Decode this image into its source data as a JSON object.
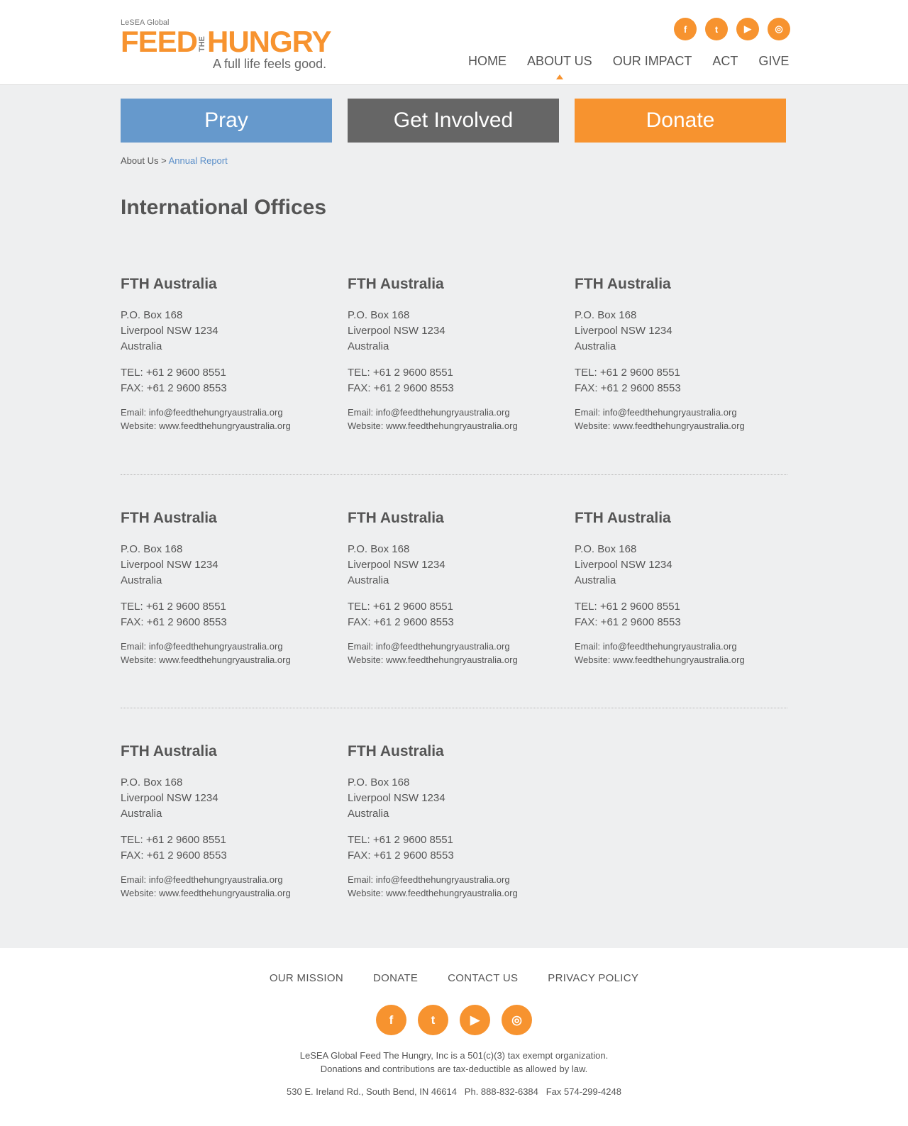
{
  "brand": {
    "small": "LeSEA Global",
    "feed": "FEED",
    "the": "THE",
    "hungry": "HUNGRY",
    "tagline": "A full life feels good."
  },
  "social_icons": [
    "facebook-icon",
    "twitter-icon",
    "youtube-icon",
    "instagram-icon"
  ],
  "social_glyphs": [
    "f",
    "t",
    "▶",
    "◎"
  ],
  "nav": {
    "items": [
      "HOME",
      "ABOUT US",
      "OUR IMPACT",
      "ACT",
      "GIVE"
    ],
    "active": "ABOUT US"
  },
  "cta": {
    "pray": "Pray",
    "involved": "Get Involved",
    "donate": "Donate"
  },
  "colors": {
    "accent": "#f7932f",
    "pray": "#6699cc",
    "involved": "#666666",
    "link": "#5b8fc9"
  },
  "breadcrumb": {
    "parent": "About Us",
    "separator": ">",
    "current": "Annual Report"
  },
  "page_title": "International Offices",
  "offices": [
    {
      "name": "FTH Australia",
      "addr1": "P.O. Box 168",
      "addr2": "Liverpool NSW 1234",
      "country": "Australia",
      "tel": "TEL: +61 2 9600 8551",
      "fax": "FAX: +61 2 9600 8553",
      "email": "Email: info@feedthehungryaustralia.org",
      "website": "Website: www.feedthehungryaustralia.org"
    },
    {
      "name": "FTH Australia",
      "addr1": "P.O. Box 168",
      "addr2": "Liverpool NSW 1234",
      "country": "Australia",
      "tel": "TEL: +61 2 9600 8551",
      "fax": "FAX: +61 2 9600 8553",
      "email": "Email: info@feedthehungryaustralia.org",
      "website": "Website: www.feedthehungryaustralia.org"
    },
    {
      "name": "FTH Australia",
      "addr1": "P.O. Box 168",
      "addr2": "Liverpool NSW 1234",
      "country": "Australia",
      "tel": "TEL: +61 2 9600 8551",
      "fax": "FAX: +61 2 9600 8553",
      "email": "Email: info@feedthehungryaustralia.org",
      "website": "Website: www.feedthehungryaustralia.org"
    },
    {
      "name": "FTH Australia",
      "addr1": "P.O. Box 168",
      "addr2": "Liverpool NSW 1234",
      "country": "Australia",
      "tel": "TEL: +61 2 9600 8551",
      "fax": "FAX: +61 2 9600 8553",
      "email": "Email: info@feedthehungryaustralia.org",
      "website": "Website: www.feedthehungryaustralia.org"
    },
    {
      "name": "FTH Australia",
      "addr1": "P.O. Box 168",
      "addr2": "Liverpool NSW 1234",
      "country": "Australia",
      "tel": "TEL: +61 2 9600 8551",
      "fax": "FAX: +61 2 9600 8553",
      "email": "Email: info@feedthehungryaustralia.org",
      "website": "Website: www.feedthehungryaustralia.org"
    },
    {
      "name": "FTH Australia",
      "addr1": "P.O. Box 168",
      "addr2": "Liverpool NSW 1234",
      "country": "Australia",
      "tel": "TEL: +61 2 9600 8551",
      "fax": "FAX: +61 2 9600 8553",
      "email": "Email: info@feedthehungryaustralia.org",
      "website": "Website: www.feedthehungryaustralia.org"
    },
    {
      "name": "FTH Australia",
      "addr1": "P.O. Box 168",
      "addr2": "Liverpool NSW 1234",
      "country": "Australia",
      "tel": "TEL: +61 2 9600 8551",
      "fax": "FAX: +61 2 9600 8553",
      "email": "Email: info@feedthehungryaustralia.org",
      "website": "Website: www.feedthehungryaustralia.org"
    },
    {
      "name": "FTH Australia",
      "addr1": "P.O. Box 168",
      "addr2": "Liverpool NSW 1234",
      "country": "Australia",
      "tel": "TEL: +61 2 9600 8551",
      "fax": "FAX: +61 2 9600 8553",
      "email": "Email: info@feedthehungryaustralia.org",
      "website": "Website: www.feedthehungryaustralia.org"
    }
  ],
  "footer": {
    "nav": [
      "OUR MISSION",
      "DONATE",
      "CONTACT US",
      "PRIVACY POLICY"
    ],
    "line1": "LeSEA Global Feed The Hungry, Inc is a 501(c)(3) tax exempt organization.",
    "line2": "Donations and contributions are tax-deductible as allowed by law.",
    "address": "530 E. Ireland Rd., South Bend, IN 46614   Ph. 888-832-6384   Fax 574-299-4248"
  }
}
